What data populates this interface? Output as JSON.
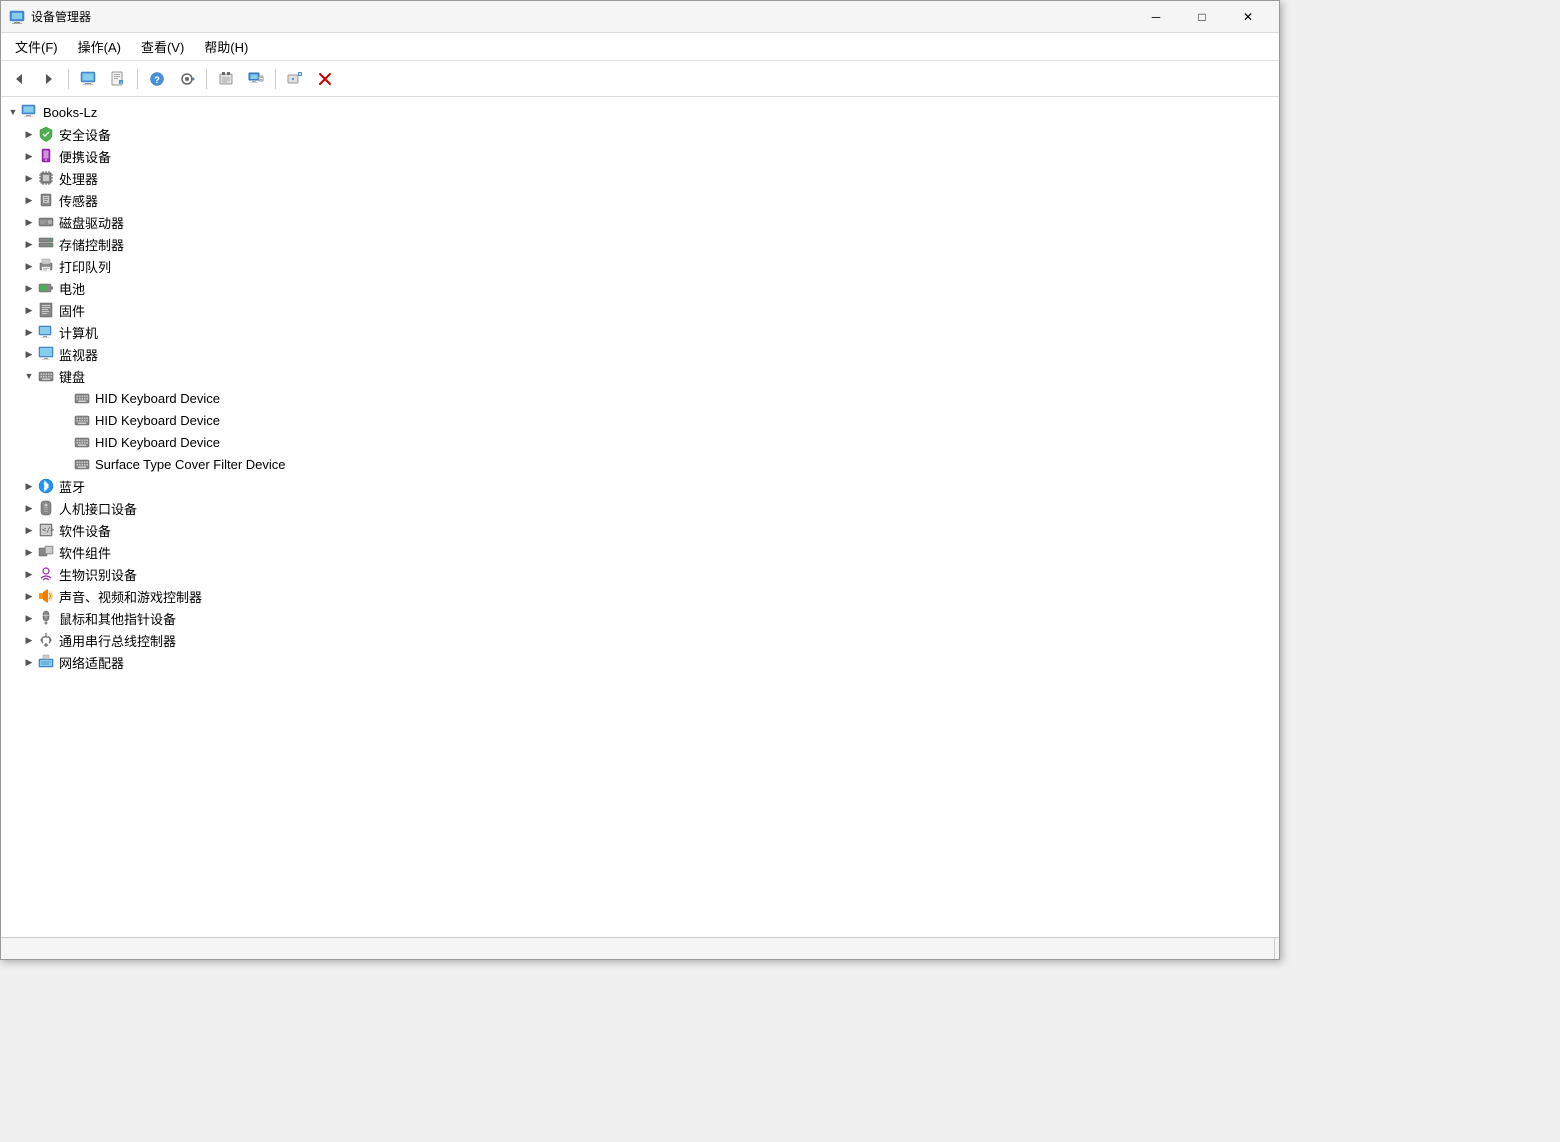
{
  "window": {
    "title": "设备管理器",
    "title_icon": "🖥️"
  },
  "title_buttons": {
    "minimize": "─",
    "maximize": "□",
    "close": "✕"
  },
  "menu": {
    "items": [
      {
        "id": "file",
        "label": "文件(F)"
      },
      {
        "id": "action",
        "label": "操作(A)"
      },
      {
        "id": "view",
        "label": "查看(V)"
      },
      {
        "id": "help",
        "label": "帮助(H)"
      }
    ]
  },
  "toolbar": {
    "buttons": [
      {
        "id": "back",
        "icon": "◀",
        "disabled": false,
        "label": "后退"
      },
      {
        "id": "forward",
        "icon": "▶",
        "disabled": false,
        "label": "前进"
      },
      {
        "id": "sep1",
        "type": "separator"
      },
      {
        "id": "devmgr",
        "icon": "🖥",
        "disabled": false,
        "label": "设备管理器"
      },
      {
        "id": "props",
        "icon": "📄",
        "disabled": false,
        "label": "属性"
      },
      {
        "id": "sep2",
        "type": "separator"
      },
      {
        "id": "help",
        "icon": "❓",
        "disabled": false,
        "label": "帮助"
      },
      {
        "id": "scan",
        "icon": "▶",
        "disabled": false,
        "label": "扫描"
      },
      {
        "id": "sep3",
        "type": "separator"
      },
      {
        "id": "action2",
        "icon": "⚙",
        "disabled": false,
        "label": "操作"
      },
      {
        "id": "display",
        "icon": "🖥",
        "disabled": false,
        "label": "显示"
      },
      {
        "id": "sep4",
        "type": "separator"
      },
      {
        "id": "add",
        "icon": "➕",
        "disabled": false,
        "label": "添加"
      },
      {
        "id": "remove",
        "icon": "✖",
        "disabled": false,
        "label": "删除",
        "red": true
      }
    ]
  },
  "tree": {
    "root": {
      "label": "Books-Lz",
      "expanded": true
    },
    "categories": [
      {
        "id": "security",
        "label": "安全设备",
        "icon": "shield",
        "expanded": false,
        "indent": 1
      },
      {
        "id": "portable",
        "label": "便携设备",
        "icon": "portable",
        "expanded": false,
        "indent": 1
      },
      {
        "id": "processor",
        "label": "处理器",
        "icon": "cpu",
        "expanded": false,
        "indent": 1
      },
      {
        "id": "sensor",
        "label": "传感器",
        "icon": "sensor",
        "expanded": false,
        "indent": 1
      },
      {
        "id": "disk",
        "label": "磁盘驱动器",
        "icon": "disk",
        "expanded": false,
        "indent": 1
      },
      {
        "id": "storage",
        "label": "存储控制器",
        "icon": "storage",
        "expanded": false,
        "indent": 1
      },
      {
        "id": "print",
        "label": "打印队列",
        "icon": "print",
        "expanded": false,
        "indent": 1
      },
      {
        "id": "battery",
        "label": "电池",
        "icon": "battery",
        "expanded": false,
        "indent": 1
      },
      {
        "id": "firmware",
        "label": "固件",
        "icon": "firmware",
        "expanded": false,
        "indent": 1
      },
      {
        "id": "computer",
        "label": "计算机",
        "icon": "computer",
        "expanded": false,
        "indent": 1
      },
      {
        "id": "monitor",
        "label": "监视器",
        "icon": "monitor",
        "expanded": false,
        "indent": 1
      },
      {
        "id": "keyboard",
        "label": "键盘",
        "icon": "keyboard",
        "expanded": true,
        "indent": 1
      },
      {
        "id": "bluetooth",
        "label": "蓝牙",
        "icon": "bluetooth",
        "expanded": false,
        "indent": 1
      },
      {
        "id": "hid",
        "label": "人机接口设备",
        "icon": "hid",
        "expanded": false,
        "indent": 1
      },
      {
        "id": "software-dev",
        "label": "软件设备",
        "icon": "software",
        "expanded": false,
        "indent": 1
      },
      {
        "id": "software-comp",
        "label": "软件组件",
        "icon": "software",
        "expanded": false,
        "indent": 1
      },
      {
        "id": "biometric",
        "label": "生物识别设备",
        "icon": "bio",
        "expanded": false,
        "indent": 1
      },
      {
        "id": "audio",
        "label": "声音、视频和游戏控制器",
        "icon": "audio",
        "expanded": false,
        "indent": 1
      },
      {
        "id": "mouse",
        "label": "鼠标和其他指针设备",
        "icon": "mouse",
        "expanded": false,
        "indent": 1
      },
      {
        "id": "serial",
        "label": "通用串行总线控制器",
        "icon": "serial",
        "expanded": false,
        "indent": 1
      },
      {
        "id": "network",
        "label": "网络适配器",
        "icon": "network",
        "expanded": false,
        "indent": 1
      }
    ],
    "keyboard_children": [
      {
        "id": "hid-kbd-1",
        "label": "HID Keyboard Device",
        "icon": "keyboard"
      },
      {
        "id": "hid-kbd-2",
        "label": "HID Keyboard Device",
        "icon": "keyboard"
      },
      {
        "id": "hid-kbd-3",
        "label": "HID Keyboard Device",
        "icon": "keyboard"
      },
      {
        "id": "surface-type",
        "label": "Surface Type Cover Filter Device",
        "icon": "keyboard"
      }
    ]
  },
  "status": {
    "text": ""
  }
}
